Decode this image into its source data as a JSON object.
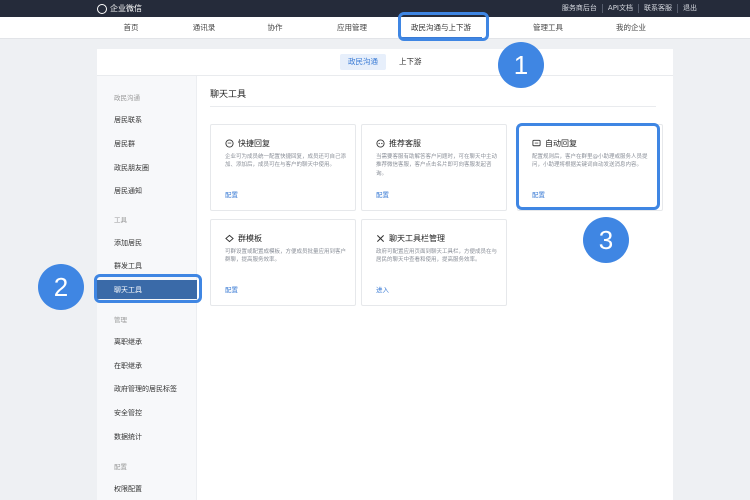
{
  "topbar": {
    "logo_text": "企业微信",
    "links": [
      "服务商后台",
      "API文档",
      "联系客服",
      "退出"
    ]
  },
  "nav": {
    "items": [
      "首页",
      "通讯录",
      "协作",
      "应用管理",
      "政民沟通与上下游",
      "管理工具",
      "我的企业"
    ],
    "active_index": 4
  },
  "subtabs": [
    "政民沟通",
    "上下游"
  ],
  "sidebar": {
    "groups": [
      {
        "title": "政民沟通",
        "items": [
          "居民联系",
          "居民群",
          "政民朋友圈",
          "居民通知"
        ]
      },
      {
        "title": "工具",
        "items": [
          "添加居民",
          "群发工具",
          "聊天工具"
        ]
      },
      {
        "title": "管理",
        "items": [
          "离职继承",
          "在职继承",
          "政府管理的居民标签",
          "安全管控",
          "数据统计"
        ]
      },
      {
        "title": "配置",
        "items": [
          "权限配置"
        ]
      }
    ],
    "active_item": "聊天工具"
  },
  "content": {
    "title": "聊天工具",
    "cards": [
      {
        "title": "快捷回复",
        "icon": "quick-reply-icon",
        "desc": "企业可为成员统一配置快捷回复，成员还可自己添加、添加后，成员可在与客户的聊天中使用。",
        "link": "配置"
      },
      {
        "title": "推荐客服",
        "icon": "recommend-service-icon",
        "desc": "当需要客服有助解答客户问题时，可在聊天中主动推荐微信客服，客户点击名片即可向客服发起咨询。",
        "link": "配置"
      },
      {
        "title": "自动回复",
        "icon": "auto-reply-icon",
        "desc": "配置规则后，客户在群里@小助理或服务人员提问，小助理将根据关键词自动发送消息内容。",
        "link": "配置"
      },
      {
        "title": "群模板",
        "icon": "group-template-icon",
        "desc": "可群设置或配置成模板，方便成员批量应用到客户群聊，提高服务效率。",
        "link": "配置"
      },
      {
        "title": "聊天工具栏管理",
        "icon": "toolbar-manage-icon",
        "desc": "政府可配置应用页面到聊天工具栏，方便成员在与居民的聊天中查看和使用，提高服务效率。",
        "link": "进入"
      }
    ]
  },
  "badges": [
    "1",
    "2",
    "3"
  ],
  "colors": {
    "accent": "#3a7bd5",
    "highlight": "#3f86e3",
    "topbar": "#252b3a",
    "sidebar_active": "#3a6aa8"
  }
}
